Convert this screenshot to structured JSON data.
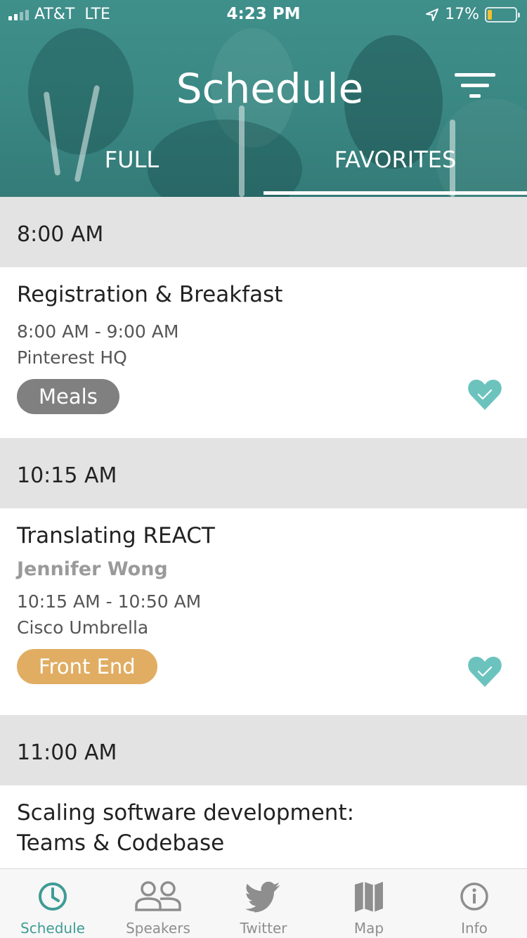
{
  "status_bar": {
    "carrier": "AT&T",
    "network": "LTE",
    "time": "4:23 PM",
    "battery": "17%",
    "battery_level": 0.17
  },
  "header": {
    "title": "Schedule",
    "tabs": [
      {
        "label": "FULL",
        "selected": false
      },
      {
        "label": "FAVORITES",
        "selected": true
      }
    ]
  },
  "schedule": [
    {
      "time": "8:00 AM",
      "sessions": [
        {
          "title": "Registration & Breakfast",
          "speaker": "",
          "time_range": "8:00 AM - 9:00 AM",
          "location": "Pinterest HQ",
          "tag": "Meals",
          "tag_color": "#808080",
          "favorited": true
        }
      ]
    },
    {
      "time": "10:15 AM",
      "sessions": [
        {
          "title": "Translating REACT",
          "speaker": "Jennifer Wong",
          "time_range": "10:15 AM - 10:50 AM",
          "location": "Cisco Umbrella",
          "tag": "Front End",
          "tag_color": "#e0ad63",
          "favorited": true
        }
      ]
    },
    {
      "time": "11:00 AM",
      "sessions": [
        {
          "title": "Scaling software development: Teams & Codebase"
        }
      ]
    }
  ],
  "tab_bar": {
    "items": [
      {
        "label": "Schedule",
        "icon": "clock-icon",
        "active": true
      },
      {
        "label": "Speakers",
        "icon": "people-icon",
        "active": false
      },
      {
        "label": "Twitter",
        "icon": "twitter-bird-icon",
        "active": false
      },
      {
        "label": "Map",
        "icon": "map-icon",
        "active": false
      },
      {
        "label": "Info",
        "icon": "info-icon",
        "active": false
      }
    ]
  },
  "colors": {
    "accent": "#3e9c95",
    "heart": "#6cc3be",
    "header_teal": "#3b8985",
    "section_gray": "#e3e3e3"
  }
}
